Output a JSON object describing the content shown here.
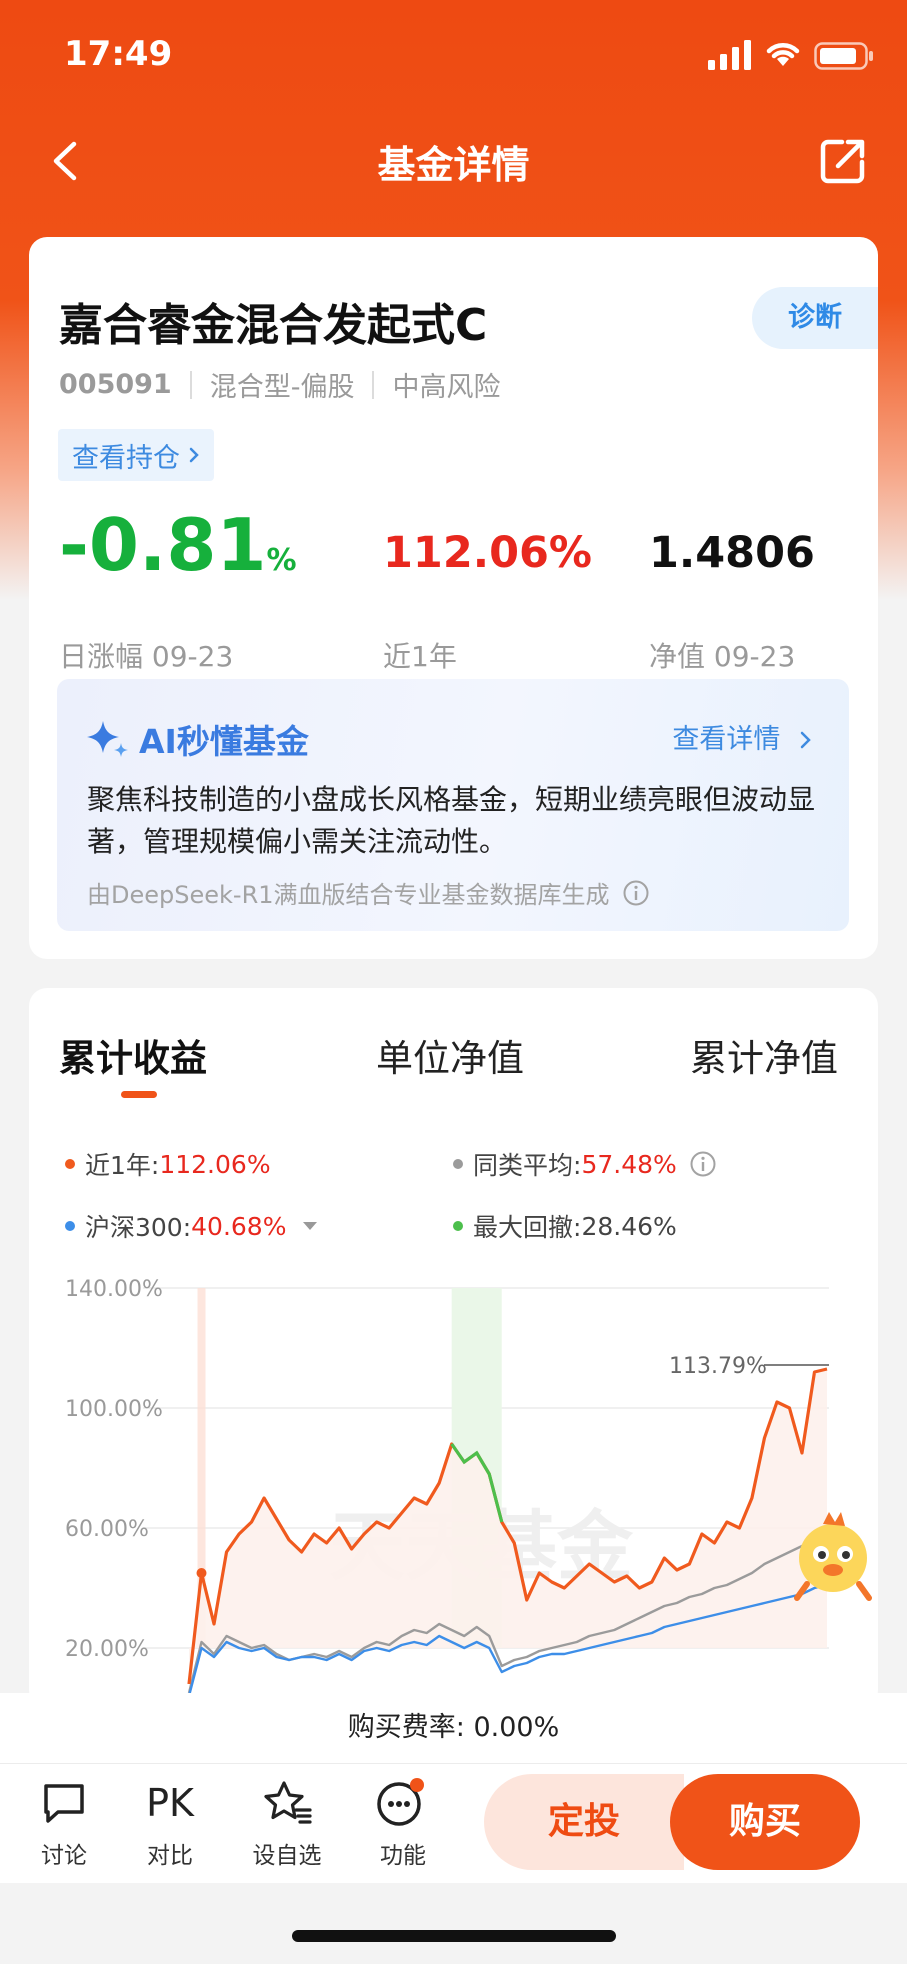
{
  "status": {
    "time": "17:49"
  },
  "nav": {
    "title": "基金详情"
  },
  "fund": {
    "name": "嘉合睿金混合发起式C",
    "diagnose_label": "诊断",
    "code": "005091",
    "type": "混合型-偏股",
    "risk": "中高风险",
    "holdings_label": "查看持仓",
    "daily_change": "-0.81",
    "daily_change_unit": "%",
    "daily_change_label": "日涨幅 09-23",
    "year_return": "112.06%",
    "year_return_label": "近1年",
    "nav_value": "1.4806",
    "nav_label": "净值 09-23"
  },
  "ai": {
    "title": "AI秒懂基金",
    "more_label": "查看详情",
    "summary": "聚焦科技制造的小盘成长风格基金，短期业绩亮眼但波动显著，管理规模偏小需关注流动性。",
    "note": "由DeepSeek-R1满血版结合专业基金数据库生成"
  },
  "tabs": [
    "累计收益",
    "单位净值",
    "累计净值"
  ],
  "legend": {
    "fund_label": "近1年:",
    "fund_value": "112.06%",
    "peer_label": "同类平均:",
    "peer_value": "57.48%",
    "index_label": "沪深300:",
    "index_value": "40.68%",
    "drawdown_label": "最大回撤:",
    "drawdown_value": "28.46%"
  },
  "colors": {
    "fund": "#f05a1e",
    "peer": "#9b9b9b",
    "index": "#3d8ee8",
    "drawdown": "#4cbf4c",
    "accent": "#f05318"
  },
  "chart_data": {
    "type": "line",
    "y_ticks": [
      "140.00%",
      "100.00%",
      "60.00%",
      "20.00%"
    ],
    "ylim": [
      20,
      140
    ],
    "peak_label": "113.79%",
    "watermark": "天天基金",
    "series": [
      {
        "name": "近1年",
        "values": [
          8,
          45,
          28,
          52,
          58,
          62,
          70,
          63,
          56,
          52,
          58,
          55,
          60,
          53,
          58,
          62,
          60,
          65,
          70,
          68,
          75,
          88,
          82,
          85,
          78,
          62,
          55,
          36,
          45,
          42,
          40,
          44,
          48,
          45,
          42,
          44,
          40,
          42,
          50,
          46,
          48,
          58,
          55,
          62,
          60,
          70,
          90,
          102,
          100,
          85,
          112,
          113
        ]
      },
      {
        "name": "同类平均",
        "values": [
          5,
          22,
          18,
          24,
          22,
          20,
          21,
          18,
          16,
          17,
          18,
          17,
          19,
          17,
          20,
          22,
          21,
          24,
          26,
          25,
          28,
          26,
          24,
          27,
          24,
          14,
          16,
          17,
          19,
          20,
          21,
          22,
          24,
          25,
          26,
          28,
          30,
          32,
          34,
          35,
          37,
          38,
          40,
          41,
          43,
          45,
          48,
          50,
          52,
          54,
          56,
          57
        ]
      },
      {
        "name": "沪深300",
        "values": [
          4,
          20,
          17,
          22,
          20,
          19,
          20,
          17,
          16,
          17,
          17,
          16,
          18,
          16,
          19,
          20,
          19,
          21,
          22,
          21,
          24,
          22,
          20,
          22,
          20,
          12,
          14,
          15,
          17,
          18,
          18,
          19,
          20,
          21,
          22,
          23,
          24,
          25,
          27,
          28,
          29,
          30,
          31,
          32,
          33,
          34,
          35,
          36,
          37,
          38,
          40,
          41
        ]
      }
    ],
    "drawdown_segment": [
      21,
      25
    ]
  },
  "fee": {
    "label": "购买费率:",
    "value": "0.00%"
  },
  "toolbar": {
    "discuss": "讨论",
    "compare_icon": "PK",
    "compare": "对比",
    "watchlist": "设自选",
    "functions": "功能",
    "auto_invest": "定投",
    "buy": "购买"
  }
}
